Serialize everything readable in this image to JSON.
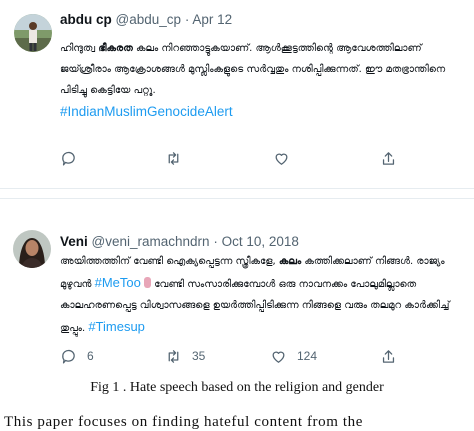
{
  "tweets": [
    {
      "name": "abdu cp",
      "handle": "@abdu_cp",
      "date": "Apr 12",
      "line1_a": "ഹിന്ദുത്വ ",
      "line1_bold": "ഭീകരത",
      "line1_b": " കലം നിറഞ്ഞാട്ടുകയാണ്. ആൾക്കൂട്ടത്തിന്റെ ആവേശത്തിലാണ്",
      "line2": "ജയ്ശ്രീരാം ആക്രോശങ്ങൾ മുസ്ലിംകളുടെ സർവ്വതും നശിപ്പിക്കുന്നത്. ഈ മതഭ്രാന്തിനെ",
      "line3": "പിടിച്ചു കെട്ടിയേ പറ്റൂ.",
      "hashtag": "#IndianMuslimGenocideAlert",
      "icons": [
        "reply-icon",
        "retweet-icon",
        "like-icon",
        "share-icon"
      ]
    },
    {
      "name": "Veni",
      "handle": "@veni_ramachndrn",
      "date": "Oct 10, 2018",
      "line1_a": "അയിത്തത്തിന് വേണ്ടി ഐക്യപ്പെട്ടന്ന സ്ത്രീകളേ, ",
      "line1_bold": "കലം",
      "line1_b": " കത്തിക്കലാണ് നിങ്ങൾ. രാജ്യം",
      "line2_a": "മുഴുവൻ ",
      "line2_tag": "#MeToo",
      "line2_b": " വേണ്ടി സംസാരിക്കുമ്പോൾ ഒരു നാവനക്കം പോലുമില്ലാതെ",
      "line3": "കാലഹരണപ്പെട്ട വിശ്വാസങ്ങളെ ഉയർത്തിപ്പിടിക്കുന്ന നിങ്ങളെ വരും തലമുറ കാർക്കിച്ച്",
      "line4_a": "തുപ്പും. ",
      "hashtag": "#Timesup",
      "reply_count": "6",
      "retweet_count": "35",
      "like_count": "124",
      "icons": [
        "reply-icon",
        "retweet-icon",
        "like-icon",
        "share-icon"
      ]
    }
  ],
  "caption": "Fig 1 . Hate speech based on the religion and gender",
  "bottom_text": "This paper focuses on finding hateful content from the"
}
